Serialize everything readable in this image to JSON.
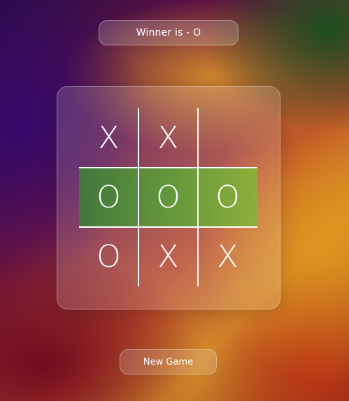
{
  "status": {
    "text": "Winner is - O"
  },
  "board": {
    "cells": [
      "X",
      "X",
      "",
      "O",
      "O",
      "O",
      "O",
      "X",
      "X"
    ],
    "winning_line": [
      3,
      4,
      5
    ],
    "winning_color": "#5f9a3a"
  },
  "controls": {
    "new_game_label": "New Game"
  },
  "colors": {
    "panel": "rgba(255,255,255,0.16)",
    "grid_lines": "#ffffff",
    "text": "#ffffff"
  }
}
